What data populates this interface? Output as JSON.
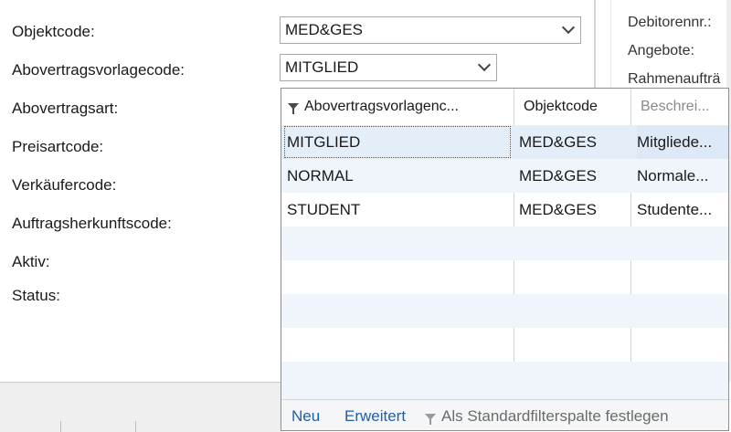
{
  "form": {
    "fields": [
      {
        "label": "Objektcode:"
      },
      {
        "label": "Abovertragsvorlagecode:"
      },
      {
        "label": "Abovertragsart:"
      },
      {
        "label": "Preisartcode:"
      },
      {
        "label": "Verkäufercode:"
      },
      {
        "label": "Auftragsherkunftscode:"
      },
      {
        "label": "Aktiv:"
      },
      {
        "label": "Status:"
      }
    ],
    "objektcode_value": "MED&GES",
    "abovertragsvorlagecode_value": "MITGLIED"
  },
  "right_panel": {
    "labels": [
      "Debitorennr.:",
      "Angebote:",
      "Rahmenaufträ"
    ]
  },
  "lookup": {
    "columns": [
      "Abovertragsvorlagenc...",
      "Objektcode",
      "Beschrei..."
    ],
    "rows": [
      {
        "code": "MITGLIED",
        "objektcode": "MED&GES",
        "beschreibung": "Mitgliede..."
      },
      {
        "code": "NORMAL",
        "objektcode": "MED&GES",
        "beschreibung": "Normale..."
      },
      {
        "code": "STUDENT",
        "objektcode": "MED&GES",
        "beschreibung": "Studente..."
      }
    ],
    "footer": {
      "new_label": "Neu",
      "advanced_label": "Erweitert",
      "set_default_filter_label": "Als Standardfilterspalte festlegen"
    }
  },
  "colors": {
    "link": "#1f5fa8",
    "selected_row": "#e3eef9",
    "border": "#8e8e8e"
  },
  "icons": [
    "filter-funnel-icon",
    "chevron-down-icon"
  ]
}
